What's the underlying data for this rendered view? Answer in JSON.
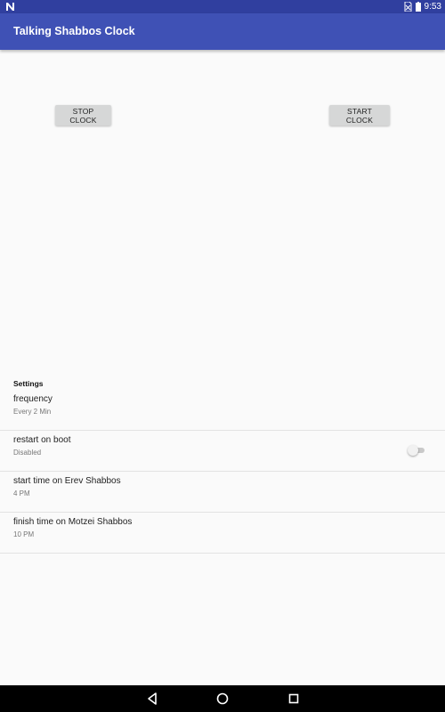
{
  "status_bar": {
    "time": "9:53",
    "left_icon": "n-notification-icon",
    "right_icons": [
      "no-sim-icon",
      "battery-icon"
    ]
  },
  "app_bar": {
    "title": "Talking Shabbos Clock",
    "color": "#3f51b5"
  },
  "buttons": {
    "stop_label": "STOP CLOCK",
    "start_label": "START CLOCK"
  },
  "settings": {
    "header": "Settings",
    "items": [
      {
        "title": "frequency",
        "summary": "Every 2 Min"
      },
      {
        "title": "restart on boot",
        "summary": "Disabled",
        "switch": false
      },
      {
        "title": "start time on Erev Shabbos",
        "summary": "4 PM"
      },
      {
        "title": "finish time on Motzei Shabbos",
        "summary": "10 PM"
      }
    ]
  },
  "nav_bar": {
    "icons": [
      "back-icon",
      "home-icon",
      "recents-icon"
    ]
  }
}
